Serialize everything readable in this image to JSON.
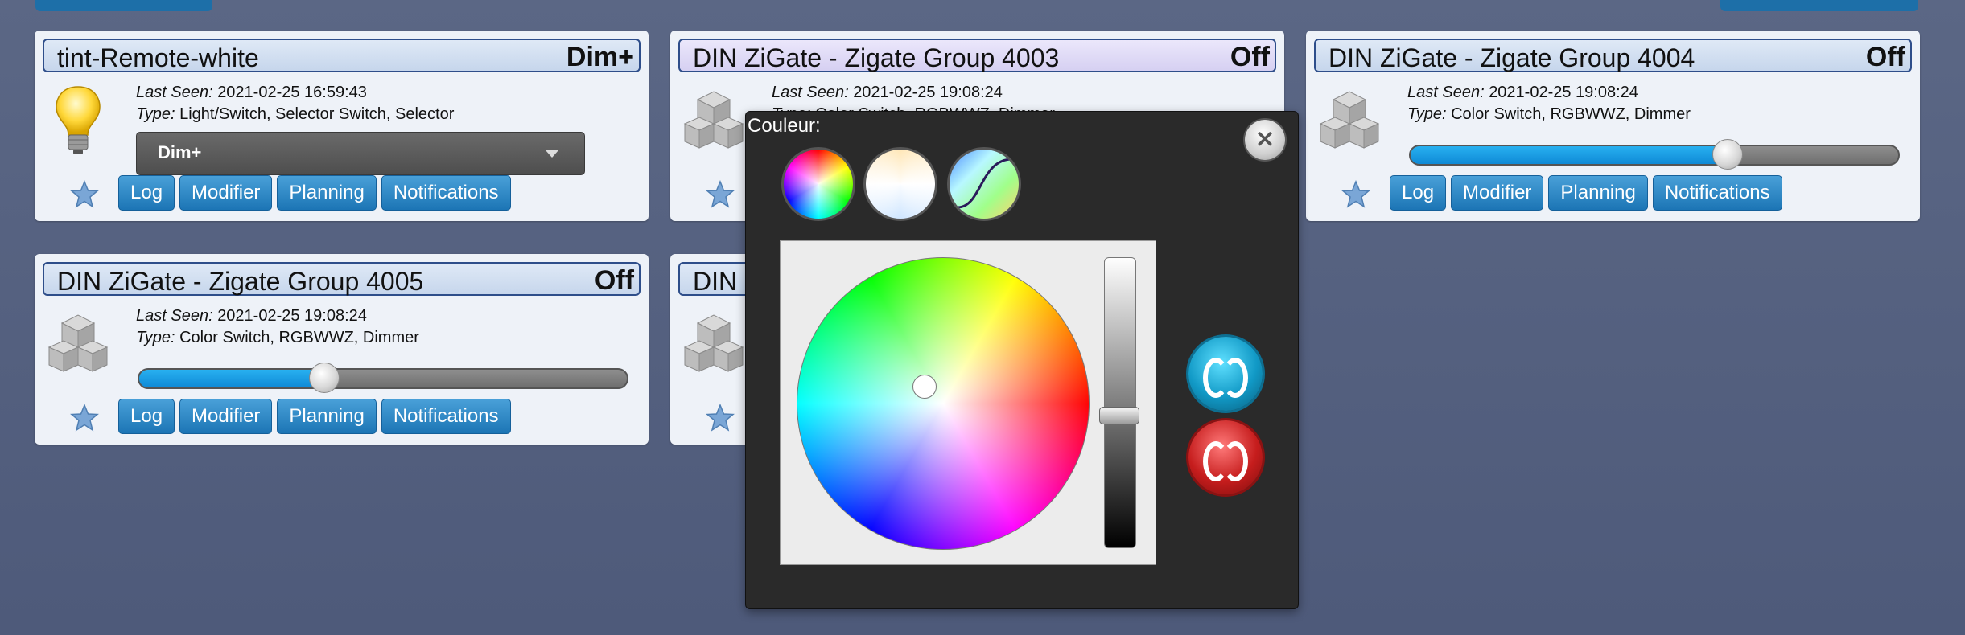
{
  "cards": [
    {
      "name": "tint-Remote-white",
      "status": "Dim+",
      "last_seen_label": "Last Seen:",
      "last_seen": "2021-02-25 16:59:43",
      "type_label": "Type:",
      "type": "Light/Switch, Selector Switch, Selector",
      "selector_value": "Dim+",
      "icon": "lightbulb-icon"
    },
    {
      "name": "DIN ZiGate - Zigate Group 4003",
      "status": "Off",
      "last_seen_label": "Last Seen:",
      "last_seen": "2021-02-25 19:08:24",
      "type_label": "Type:",
      "type": "Color Switch, RGBWWZ, Dimmer",
      "icon": "cubes-icon"
    },
    {
      "name": "DIN ZiGate - Zigate Group 4004",
      "status": "Off",
      "last_seen_label": "Last Seen:",
      "last_seen": "2021-02-25 19:08:24",
      "type_label": "Type:",
      "type": "Color Switch, RGBWWZ, Dimmer",
      "dimmer_level": 0.65,
      "icon": "cubes-icon"
    },
    {
      "name": "DIN ZiGate - Zigate Group 4005",
      "status": "Off",
      "last_seen_label": "Last Seen:",
      "last_seen": "2021-02-25 19:08:24",
      "type_label": "Type:",
      "type": "Color Switch, RGBWWZ, Dimmer",
      "dimmer_level": 0.38,
      "icon": "cubes-icon"
    },
    {
      "name": "DIN",
      "icon": "cubes-icon"
    }
  ],
  "buttons": {
    "log": "Log",
    "modifier": "Modifier",
    "planning": "Planning",
    "notifications": "Notifications"
  },
  "color_popup": {
    "title": "Couleur:",
    "brightness_level": 0.38,
    "modes": [
      "rgb-mode-icon",
      "white-mode-icon",
      "temperature-mode-icon"
    ],
    "colors": {
      "apply": "#1199c6",
      "cancel": "#c61d1d"
    }
  }
}
